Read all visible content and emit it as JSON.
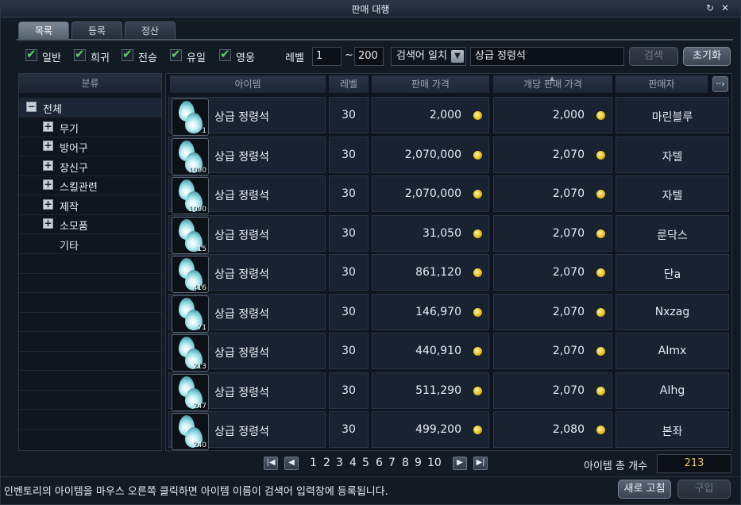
{
  "window": {
    "title": "판매 대행",
    "tabs": [
      {
        "label": "목록",
        "active": true
      },
      {
        "label": "등록",
        "active": false
      },
      {
        "label": "정산",
        "active": false
      }
    ]
  },
  "filters": {
    "grades": [
      {
        "label": "일반",
        "checked": true
      },
      {
        "label": "희귀",
        "checked": true
      },
      {
        "label": "전승",
        "checked": true
      },
      {
        "label": "유일",
        "checked": true
      },
      {
        "label": "영웅",
        "checked": true
      }
    ],
    "level_label": "레벨",
    "level_min": "1",
    "level_sep": "~",
    "level_max": "200",
    "match_label": "검색어 일치",
    "search_value": "상급 정령석",
    "search_button": "검색",
    "reset_button": "초기화"
  },
  "categories": {
    "header": "분류",
    "items": [
      {
        "label": "전체",
        "expander": "−",
        "selected": true
      },
      {
        "label": "무기",
        "expander": "+"
      },
      {
        "label": "방어구",
        "expander": "+"
      },
      {
        "label": "장신구",
        "expander": "+"
      },
      {
        "label": "스킬관련",
        "expander": "+"
      },
      {
        "label": "제작",
        "expander": "+"
      },
      {
        "label": "소모품",
        "expander": "+"
      },
      {
        "label": "기타",
        "expander": ""
      }
    ]
  },
  "table": {
    "columns": [
      "아이템",
      "레벨",
      "판매 가격",
      "개당 판매 가격",
      "판매자"
    ],
    "more_button": "··›",
    "rows": [
      {
        "qty": "1",
        "name": "상급 정령석",
        "level": "30",
        "price": "2,000",
        "unit_price": "2,000",
        "seller": "마린블루"
      },
      {
        "qty": "1000",
        "name": "상급 정령석",
        "level": "30",
        "price": "2,070,000",
        "unit_price": "2,070",
        "seller": "자텔"
      },
      {
        "qty": "1000",
        "name": "상급 정령석",
        "level": "30",
        "price": "2,070,000",
        "unit_price": "2,070",
        "seller": "자텔"
      },
      {
        "qty": "15",
        "name": "상급 정령석",
        "level": "30",
        "price": "31,050",
        "unit_price": "2,070",
        "seller": "룬닥스"
      },
      {
        "qty": "416",
        "name": "상급 정령석",
        "level": "30",
        "price": "861,120",
        "unit_price": "2,070",
        "seller": "단a"
      },
      {
        "qty": "71",
        "name": "상급 정령석",
        "level": "30",
        "price": "146,970",
        "unit_price": "2,070",
        "seller": "Nxzag"
      },
      {
        "qty": "213",
        "name": "상급 정령석",
        "level": "30",
        "price": "440,910",
        "unit_price": "2,070",
        "seller": "AImx"
      },
      {
        "qty": "247",
        "name": "상급 정령석",
        "level": "30",
        "price": "511,290",
        "unit_price": "2,070",
        "seller": "AIhg"
      },
      {
        "qty": "240",
        "name": "상급 정령석",
        "level": "30",
        "price": "499,200",
        "unit_price": "2,080",
        "seller": "본좌"
      }
    ]
  },
  "pagination": {
    "pages": [
      "1",
      "2",
      "3",
      "4",
      "5",
      "6",
      "7",
      "8",
      "9",
      "10"
    ],
    "first": "|◀",
    "prev": "◀",
    "next": "▶",
    "last": "▶|"
  },
  "total": {
    "label": "아이템 총 개수",
    "value": "213"
  },
  "footer": {
    "hint": "인벤토리의 아이템을 마우스 오른쪽 클릭하면 아이템 이름이 검색어 입력창에 등록됩니다.",
    "refresh_button": "새로 고침",
    "buy_button": "구입"
  },
  "colors": {
    "accent": "#57d15a",
    "coin": "#e8c020",
    "total": "#e8c060"
  }
}
